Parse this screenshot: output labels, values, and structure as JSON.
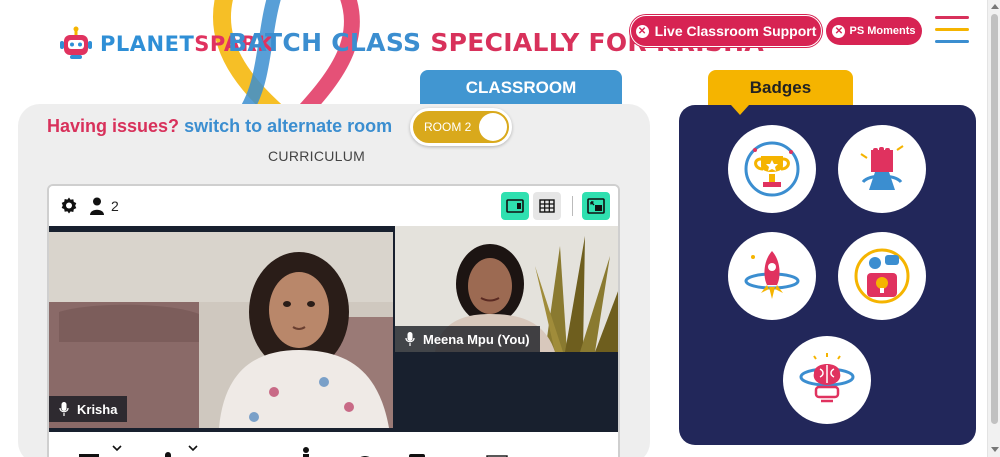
{
  "header": {
    "logo_text_a": "PLANET",
    "logo_text_b": "SPARK",
    "title_part1": "BATCH CLASS",
    "title_part2": "SPECIALLY FOR KRISHA",
    "live_support_label": "Live Classroom Support",
    "ps_moments_label": "PS Moments",
    "menu_icon": "hamburger-menu-icon"
  },
  "tabs": {
    "classroom_label": "CLASSROOM",
    "badges_label": "Badges"
  },
  "classroom": {
    "issue_question": "Having issues?",
    "issue_action": "switch to alternate room",
    "room_toggle_label": "ROOM 2",
    "curriculum_label": "CURRICULUM"
  },
  "video": {
    "participant_count": "2",
    "toolbar_icons": [
      "settings-icon",
      "participants-icon",
      "speaker-view-icon",
      "grid-view-icon",
      "picture-in-picture-icon"
    ],
    "participants": [
      {
        "name": "Krisha"
      },
      {
        "name": "Meena Mpu (You)"
      }
    ]
  },
  "badges": {
    "icons": [
      "trophy-badge-icon",
      "fist-power-badge-icon",
      "rocket-badge-icon",
      "idea-badge-icon",
      "brain-badge-icon"
    ]
  },
  "colors": {
    "brand_blue": "#3b8ed0",
    "brand_pink": "#d8315b",
    "badge_yellow": "#f5b400",
    "badges_bg": "#22275a",
    "teal_active": "#2fe0b0"
  }
}
